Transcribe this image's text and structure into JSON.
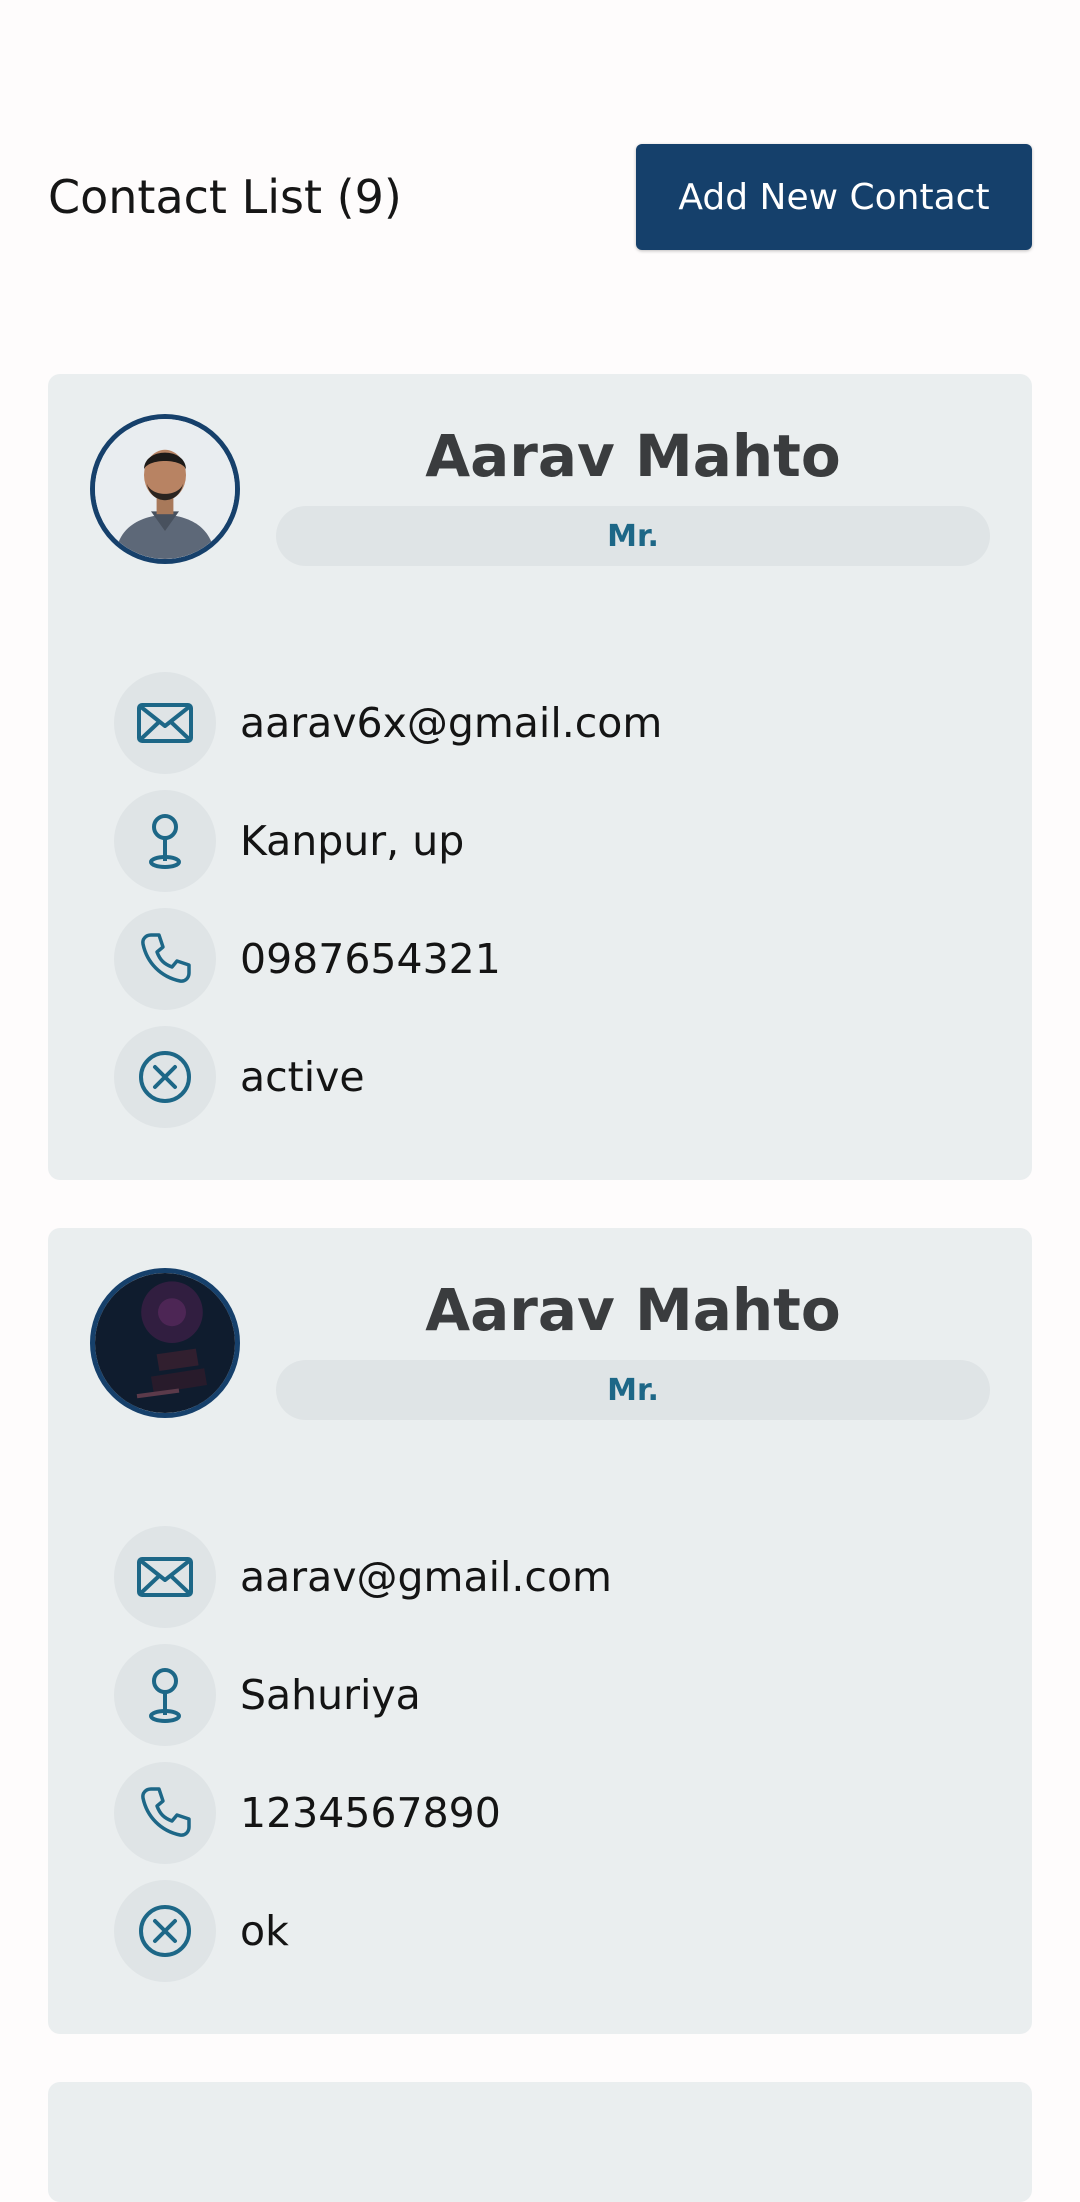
{
  "header": {
    "title": "Contact List (9)",
    "add_button_label": "Add New Contact"
  },
  "colors": {
    "primary": "#15406b",
    "accent": "#1d6787",
    "card_bg": "#eaeeef"
  },
  "contacts": [
    {
      "name": "Aarav Mahto",
      "title": "Mr.",
      "email": "aarav6x@gmail.com",
      "address": "Kanpur, up",
      "phone": "0987654321",
      "status": "active",
      "avatar_icon": "person-photo"
    },
    {
      "name": "Aarav Mahto",
      "title": "Mr.",
      "email": "aarav@gmail.com",
      "address": "Sahuriya",
      "phone": "1234567890",
      "status": "ok",
      "avatar_icon": "dark-photo"
    }
  ]
}
